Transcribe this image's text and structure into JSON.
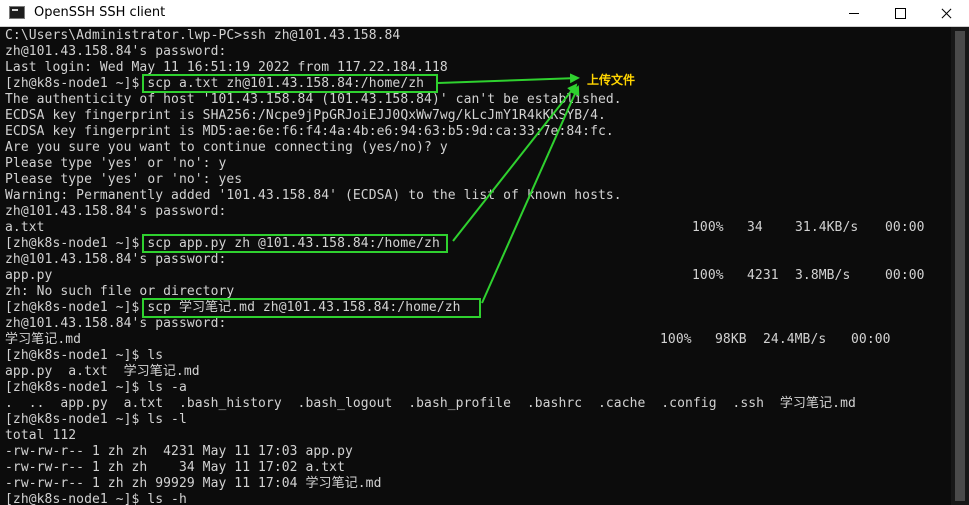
{
  "window": {
    "title": "OpenSSH SSH client",
    "icon": "terminal-icon",
    "controls": {
      "minimize": "minimize-icon",
      "maximize": "maximize-icon",
      "close": "close-icon"
    }
  },
  "terminal": {
    "lines": [
      {
        "text": "C:\\Users\\Administrator.lwp-PC>ssh zh@101.43.158.84"
      },
      {
        "text": "zh@101.43.158.84's password:"
      },
      {
        "text": "Last login: Wed May 11 16:51:19 2022 from 117.22.184.118"
      },
      {
        "text": "[zh@k8s-node1 ~]$ scp a.txt zh@101.43.158.84:/home/zh"
      },
      {
        "text": "The authenticity of host '101.43.158.84 (101.43.158.84)' can't be established."
      },
      {
        "text": "ECDSA key fingerprint is SHA256:/Ncpe9jPpGRJoiEJJ0QxWw7wg/kLcJmY1R4kKKSYB/4."
      },
      {
        "text": "ECDSA key fingerprint is MD5:ae:6e:f6:f4:4a:4b:e6:94:63:b5:9d:ca:33:7e:84:fc."
      },
      {
        "text": "Are you sure you want to continue connecting (yes/no)? y"
      },
      {
        "text": "Please type 'yes' or 'no': y"
      },
      {
        "text": "Please type 'yes' or 'no': yes"
      },
      {
        "text": "Warning: Permanently added '101.43.158.84' (ECDSA) to the list of known hosts."
      },
      {
        "text": "zh@101.43.158.84's password:"
      },
      {
        "text": "a.txt",
        "percent": "100%",
        "size": "34",
        "rate": "31.4KB/s",
        "eta": "00:00"
      },
      {
        "text": "[zh@k8s-node1 ~]$ scp app.py zh @101.43.158.84:/home/zh"
      },
      {
        "text": "zh@101.43.158.84's password:"
      },
      {
        "text": "app.py",
        "percent": "100%",
        "size": "4231",
        "rate": "3.8MB/s",
        "eta": "00:00"
      },
      {
        "text": "zh: No such file or directory"
      },
      {
        "text": "[zh@k8s-node1 ~]$ scp 学习笔记.md zh@101.43.158.84:/home/zh"
      },
      {
        "text": "zh@101.43.158.84's password:"
      },
      {
        "text": "学习笔记.md",
        "percent": "100%",
        "size": "98KB",
        "rate": "24.4MB/s",
        "eta": "00:00"
      },
      {
        "text": "[zh@k8s-node1 ~]$ ls"
      },
      {
        "text": "app.py  a.txt  学习笔记.md"
      },
      {
        "text": "[zh@k8s-node1 ~]$ ls -a"
      },
      {
        "text": ".  ..  app.py  a.txt  .bash_history  .bash_logout  .bash_profile  .bashrc  .cache  .config  .ssh  学习笔记.md"
      },
      {
        "text": "[zh@k8s-node1 ~]$ ls -l"
      },
      {
        "text": "total 112"
      },
      {
        "text": "-rw-rw-r-- 1 zh zh  4231 May 11 17:03 app.py"
      },
      {
        "text": "-rw-rw-r-- 1 zh zh    34 May 11 17:02 a.txt"
      },
      {
        "text": "-rw-rw-r-- 1 zh zh 99929 May 11 17:04 学习笔记.md"
      },
      {
        "text": "[zh@k8s-node1 ~]$ ls -h"
      }
    ]
  },
  "annotation": {
    "label": "上传文件",
    "box_color": "#2fd12f",
    "label_color": "#ffd400"
  },
  "colors": {
    "terminal_bg": "#0c0c0c",
    "terminal_fg": "#d2d2d2",
    "titlebar_bg": "#ffffff"
  }
}
